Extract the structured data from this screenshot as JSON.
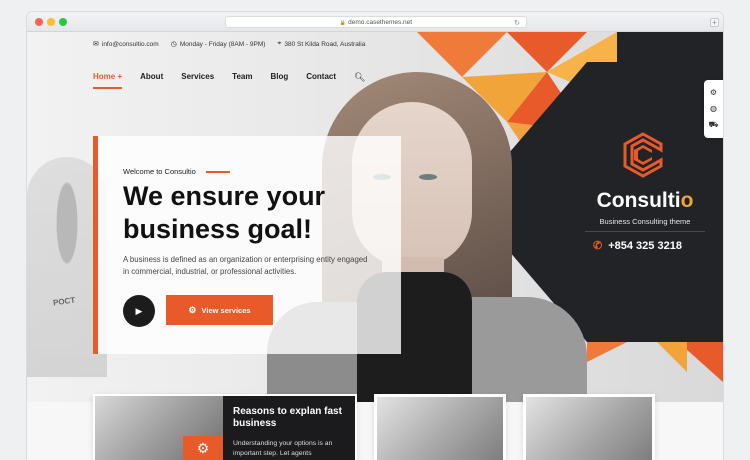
{
  "browser": {
    "url": "demo.casethemes.net"
  },
  "topbar": {
    "email": "info@consultio.com",
    "hours": "Monday - Friday (8AM - 9PM)",
    "address": "380 St Kilda Road, Australia"
  },
  "nav": {
    "items": [
      "Home +",
      "About",
      "Services",
      "Team",
      "Blog",
      "Contact"
    ]
  },
  "hero": {
    "welcome": "Welcome to Consultio",
    "headline_line1": "We ensure your",
    "headline_line2": "business goal!",
    "description": "A business is defined as an organization or enterprising entity engaged in commercial, industrial, or professional activities.",
    "cta_label": "View services",
    "badge_text": "POCT"
  },
  "brand": {
    "name_main": "Consulti",
    "name_accent": "o",
    "tagline": "Business Consulting theme",
    "phone": "+854 325 3218"
  },
  "cards": {
    "first_title": "Reasons to explan fast business",
    "first_text": "Understanding your options is an important step. Let agents"
  },
  "colors": {
    "accent": "#e85a2a",
    "accent_light": "#f0a43a",
    "dark": "#222326"
  }
}
